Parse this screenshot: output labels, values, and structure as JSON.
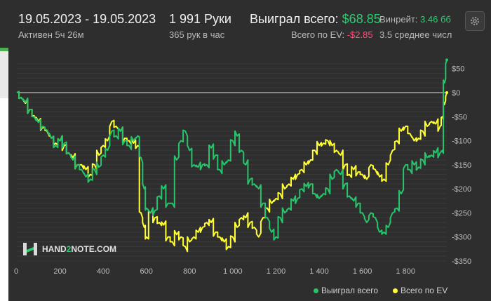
{
  "header": {
    "date_range": "19.05.2023 - 19.05.2023",
    "active_time": "Активен 5ч 26м",
    "hands_count": "1 991 Руки",
    "hands_rate": "365 рук в час",
    "won_total_label": "Выиграл всего:",
    "won_total_value": "$68.85",
    "ev_total_label": "Всего по EV:",
    "ev_total_value": "-$2.85",
    "winrate_label": "Винрейт:",
    "winrate_value": "3.46 бб",
    "avg_text": "3.5 среднее числ"
  },
  "logo": {
    "brand_prefix": "HAND",
    "brand_digit": "2",
    "brand_suffix": "NOTE.COM"
  },
  "legend": {
    "won": "Выиграл всего",
    "ev": "Всего по EV"
  },
  "colors": {
    "won": "#27c46b",
    "ev": "#ffff33",
    "zero_line": "#e0e0e0"
  },
  "chart_data": {
    "type": "line",
    "x_ticks": [
      "0",
      "200",
      "400",
      "600",
      "800",
      "1 000",
      "1 200",
      "1 400",
      "1 600",
      "1 800"
    ],
    "y_ticks": [
      "$50",
      "$0",
      "-$50",
      "-$100",
      "-$150",
      "-$200",
      "-$250",
      "-$300",
      "-$350"
    ],
    "xlim": [
      0,
      1991
    ],
    "ylim": [
      -350,
      70
    ],
    "series": [
      {
        "name": "Выиграл всего",
        "x": [
          0,
          20,
          40,
          60,
          80,
          100,
          120,
          140,
          160,
          180,
          200,
          220,
          240,
          260,
          280,
          300,
          320,
          340,
          360,
          380,
          400,
          420,
          440,
          460,
          480,
          500,
          520,
          540,
          560,
          575,
          590,
          600,
          620,
          640,
          660,
          680,
          700,
          720,
          740,
          760,
          780,
          800,
          820,
          840,
          860,
          880,
          900,
          920,
          940,
          960,
          980,
          1000,
          1020,
          1040,
          1060,
          1080,
          1100,
          1120,
          1140,
          1160,
          1180,
          1200,
          1220,
          1240,
          1260,
          1280,
          1300,
          1320,
          1340,
          1360,
          1380,
          1400,
          1420,
          1440,
          1460,
          1480,
          1500,
          1520,
          1540,
          1560,
          1580,
          1600,
          1620,
          1640,
          1660,
          1680,
          1700,
          1720,
          1740,
          1760,
          1780,
          1800,
          1820,
          1840,
          1860,
          1880,
          1900,
          1920,
          1940,
          1960,
          1970,
          1980,
          1991
        ],
        "y": [
          0,
          -10,
          -20,
          -35,
          -50,
          -62,
          -70,
          -78,
          -95,
          -110,
          -100,
          -105,
          -125,
          -140,
          -150,
          -160,
          -175,
          -180,
          -160,
          -155,
          -130,
          -120,
          -80,
          -90,
          -80,
          -100,
          -110,
          -100,
          -90,
          -135,
          -200,
          -240,
          -250,
          -245,
          -215,
          -200,
          -230,
          -230,
          -140,
          -100,
          -80,
          -120,
          -150,
          -155,
          -150,
          -150,
          -115,
          -130,
          -160,
          -150,
          -140,
          -100,
          -90,
          -120,
          -150,
          -180,
          -190,
          -200,
          -230,
          -260,
          -290,
          -300,
          -260,
          -250,
          -240,
          -225,
          -220,
          -200,
          -195,
          -190,
          -210,
          -220,
          -210,
          -200,
          -180,
          -160,
          -170,
          -190,
          -215,
          -225,
          -230,
          -250,
          -270,
          -250,
          -260,
          -290,
          -290,
          -280,
          -250,
          -240,
          -210,
          -150,
          -160,
          -150,
          -155,
          -140,
          -135,
          -130,
          -125,
          -125,
          -120,
          20,
          68
        ]
      },
      {
        "name": "Всего по EV",
        "x": [
          0,
          20,
          40,
          60,
          80,
          100,
          120,
          140,
          160,
          180,
          200,
          220,
          240,
          260,
          280,
          300,
          320,
          340,
          360,
          380,
          400,
          420,
          440,
          460,
          480,
          500,
          520,
          540,
          560,
          575,
          590,
          600,
          620,
          640,
          660,
          680,
          700,
          720,
          740,
          760,
          780,
          800,
          820,
          840,
          860,
          880,
          900,
          920,
          940,
          960,
          980,
          1000,
          1020,
          1040,
          1060,
          1080,
          1100,
          1120,
          1140,
          1160,
          1180,
          1200,
          1220,
          1240,
          1260,
          1280,
          1300,
          1320,
          1340,
          1360,
          1380,
          1400,
          1420,
          1440,
          1460,
          1480,
          1500,
          1520,
          1540,
          1560,
          1580,
          1600,
          1620,
          1640,
          1660,
          1680,
          1700,
          1720,
          1740,
          1760,
          1780,
          1800,
          1820,
          1840,
          1860,
          1880,
          1900,
          1920,
          1940,
          1960,
          1970,
          1980,
          1991
        ],
        "y": [
          0,
          -10,
          -22,
          -35,
          -48,
          -60,
          -72,
          -80,
          -95,
          -105,
          -100,
          -110,
          -125,
          -135,
          -150,
          -150,
          -160,
          -170,
          -150,
          -130,
          -110,
          -100,
          -60,
          -70,
          -80,
          -95,
          -100,
          -105,
          -110,
          -250,
          -280,
          -300,
          -250,
          -260,
          -270,
          -275,
          -300,
          -310,
          -295,
          -300,
          -320,
          -310,
          -300,
          -290,
          -280,
          -270,
          -270,
          -290,
          -300,
          -310,
          -320,
          -300,
          -280,
          -260,
          -260,
          -270,
          -280,
          -300,
          -260,
          -240,
          -230,
          -220,
          -210,
          -200,
          -190,
          -180,
          -170,
          -160,
          -150,
          -140,
          -120,
          -110,
          -105,
          -100,
          -110,
          -120,
          -130,
          -150,
          -170,
          -160,
          -165,
          -170,
          -180,
          -150,
          -160,
          -175,
          -180,
          -150,
          -120,
          -100,
          -80,
          -70,
          -85,
          -100,
          -95,
          -80,
          -70,
          -60,
          -65,
          -70,
          -50,
          -25,
          0
        ]
      }
    ]
  }
}
